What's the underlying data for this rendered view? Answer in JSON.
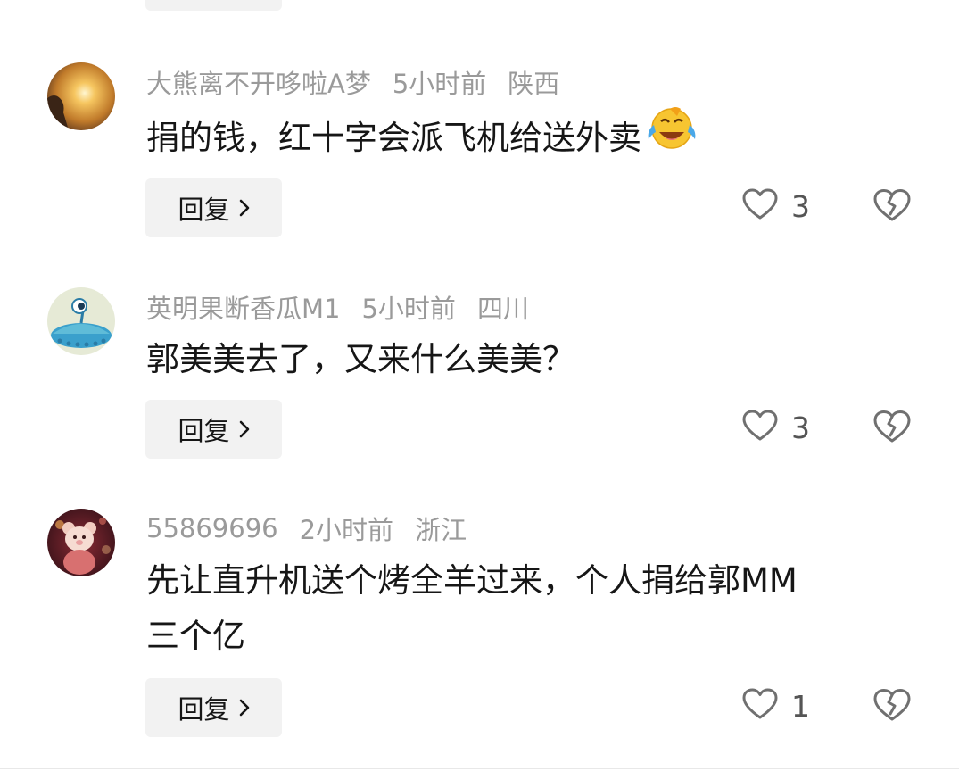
{
  "comments": [
    {
      "username": "大熊离不开哆啦A梦",
      "time": "5小时前",
      "location": "陕西",
      "text": "捐的钱，红十字会派飞机给送外卖",
      "emoji": "rolling-on-floor-laughing",
      "reply_label": "回复",
      "likes": "3"
    },
    {
      "username": "英明果断香瓜M1",
      "time": "5小时前",
      "location": "四川",
      "text": "郭美美去了，又来什么美美？",
      "reply_label": "回复",
      "likes": "3"
    },
    {
      "username": "55869696",
      "time": "2小时前",
      "location": "浙江",
      "text_line1": "先让直升机送个烤全羊过来，个人捐给郭MM",
      "text_line2": "三个亿",
      "reply_label": "回复",
      "likes": "1"
    }
  ],
  "icons": {
    "like": "heart-outline-icon",
    "dislike": "broken-heart-icon",
    "reply_arrow": "chevron-right-icon"
  }
}
